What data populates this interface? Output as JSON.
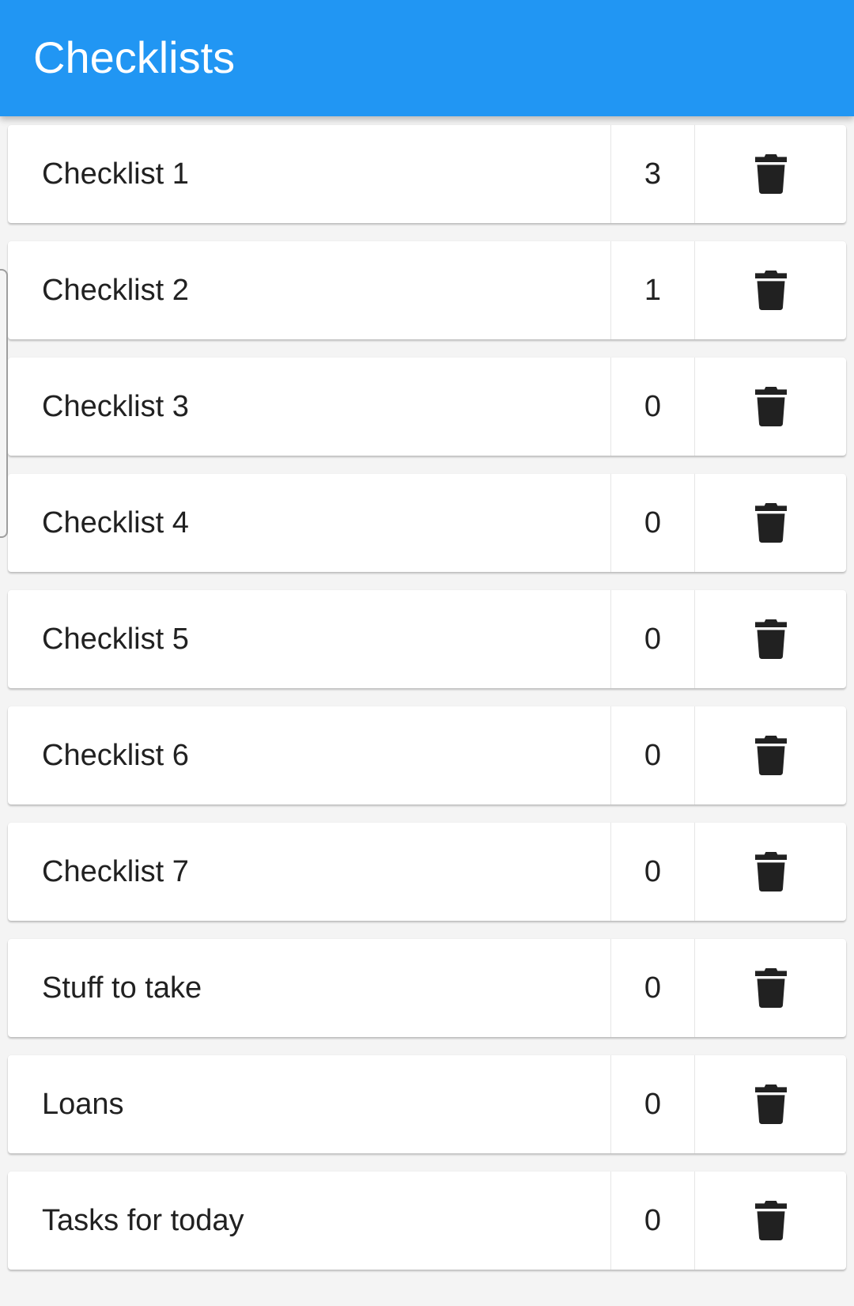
{
  "app_bar": {
    "title": "Checklists",
    "color": "#2196f3"
  },
  "checklists": [
    {
      "name": "Checklist 1",
      "count": "3",
      "delete_icon": "trash-icon"
    },
    {
      "name": "Checklist 2",
      "count": "1",
      "delete_icon": "trash-icon"
    },
    {
      "name": "Checklist 3",
      "count": "0",
      "delete_icon": "trash-icon"
    },
    {
      "name": "Checklist 4",
      "count": "0",
      "delete_icon": "trash-icon"
    },
    {
      "name": "Checklist 5",
      "count": "0",
      "delete_icon": "trash-icon"
    },
    {
      "name": "Checklist 6",
      "count": "0",
      "delete_icon": "trash-icon"
    },
    {
      "name": "Checklist 7",
      "count": "0",
      "delete_icon": "trash-icon"
    },
    {
      "name": "Stuff to take",
      "count": "0",
      "delete_icon": "trash-icon"
    },
    {
      "name": "Loans",
      "count": "0",
      "delete_icon": "trash-icon"
    },
    {
      "name": "Tasks for today",
      "count": "0",
      "delete_icon": "trash-icon"
    }
  ]
}
